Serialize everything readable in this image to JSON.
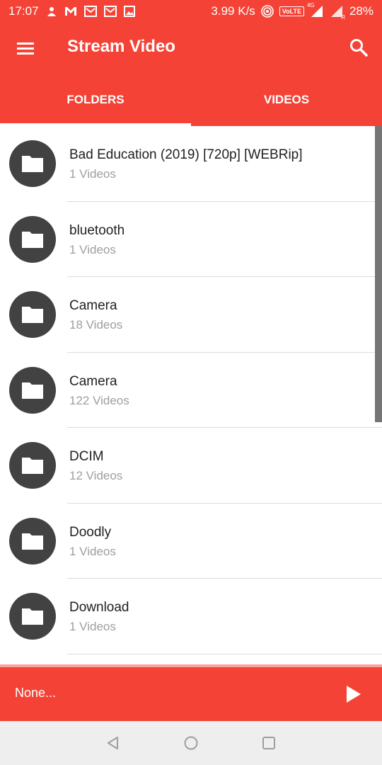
{
  "status_bar": {
    "time": "17:07",
    "speed": "3.99 K/s",
    "volte": "VoLTE",
    "network": "4G",
    "roaming": "R",
    "battery": "28%"
  },
  "app_bar": {
    "title": "Stream Video",
    "menu_icon": "hamburger-menu-icon",
    "search_icon": "search-icon"
  },
  "tabs": [
    {
      "label": "FOLDERS",
      "selected": true
    },
    {
      "label": "VIDEOS",
      "selected": false
    }
  ],
  "folders": [
    {
      "name": "Bad Education (2019) [720p] [WEBRip]",
      "count": "1 Videos"
    },
    {
      "name": "bluetooth",
      "count": "1 Videos"
    },
    {
      "name": "Camera",
      "count": "18 Videos"
    },
    {
      "name": "Camera",
      "count": "122 Videos"
    },
    {
      "name": "DCIM",
      "count": "12 Videos"
    },
    {
      "name": "Doodly",
      "count": "1 Videos"
    },
    {
      "name": "Download",
      "count": "1 Videos"
    }
  ],
  "player": {
    "now_playing": "None...",
    "play_icon": "play-icon"
  },
  "colors": {
    "primary": "#f44336",
    "avatar": "#424242",
    "secondary_text": "#9e9e9e"
  }
}
